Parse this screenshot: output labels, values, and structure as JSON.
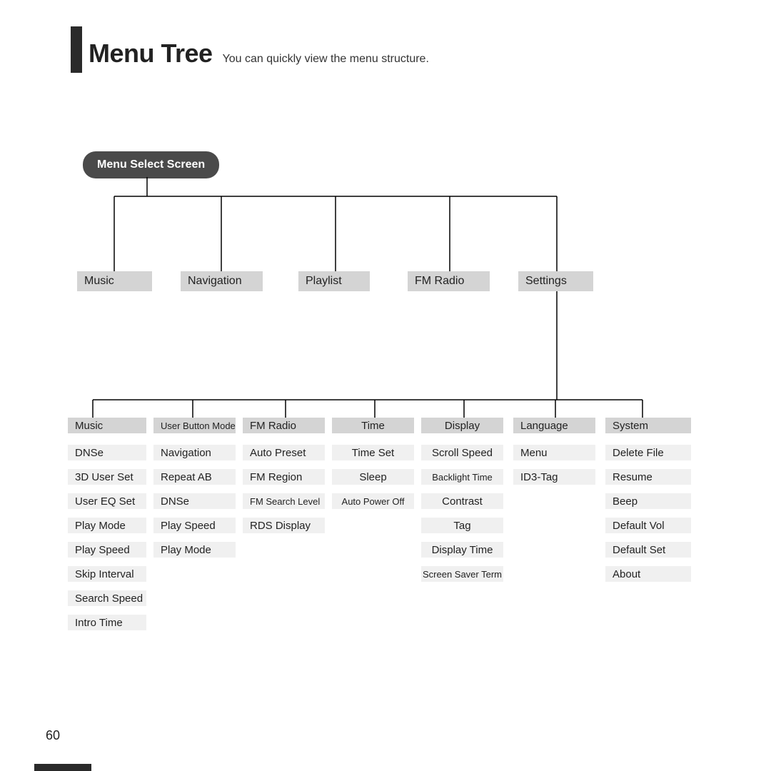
{
  "header": {
    "title": "Menu Tree",
    "subtitle": "You can quickly view the menu structure."
  },
  "root": {
    "label": "Menu Select Screen"
  },
  "level1": [
    {
      "label": "Music"
    },
    {
      "label": "Navigation"
    },
    {
      "label": "Playlist"
    },
    {
      "label": "FM Radio"
    },
    {
      "label": "Settings"
    }
  ],
  "settings_submenus": [
    {
      "head": "Music",
      "items": [
        "DNSe",
        "3D User Set",
        "User EQ Set",
        "Play Mode",
        "Play Speed",
        "Skip Interval",
        "Search Speed",
        "Intro Time"
      ]
    },
    {
      "head": "User Button Mode",
      "items": [
        "Navigation",
        "Repeat AB",
        "DNSe",
        "Play Speed",
        "Play Mode"
      ]
    },
    {
      "head": "FM Radio",
      "items": [
        "Auto Preset",
        "FM Region",
        "FM Search Level",
        "RDS Display"
      ]
    },
    {
      "head": "Time",
      "items": [
        "Time Set",
        "Sleep",
        "Auto Power Off"
      ]
    },
    {
      "head": "Display",
      "items": [
        "Scroll Speed",
        "Backlight Time",
        "Contrast",
        "Tag",
        "Display Time",
        "Screen Saver Term"
      ]
    },
    {
      "head": "Language",
      "items": [
        "Menu",
        "ID3-Tag"
      ]
    },
    {
      "head": "System",
      "items": [
        "Delete File",
        "Resume",
        "Beep",
        "Default Vol",
        "Default Set",
        "About"
      ]
    }
  ],
  "page_number": "60"
}
